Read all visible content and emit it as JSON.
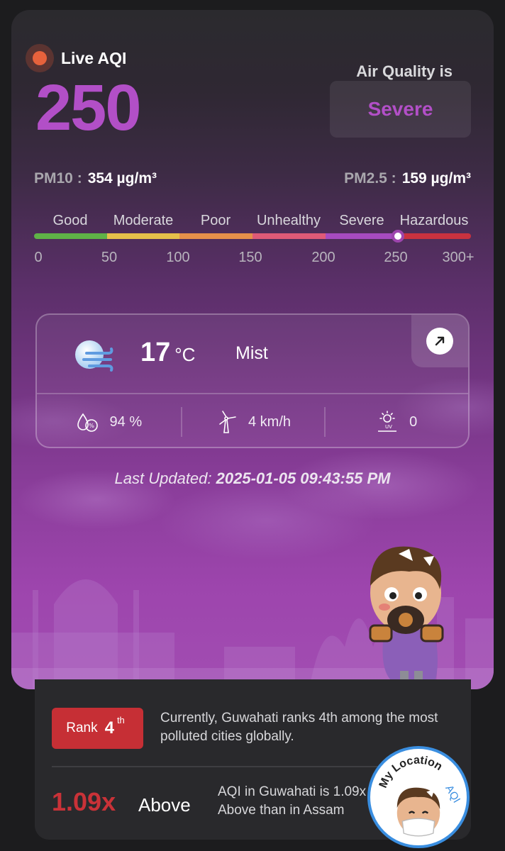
{
  "header": {
    "live_label": "Live AQI",
    "aqi_value": "250",
    "air_quality_label": "Air Quality is",
    "status": "Severe"
  },
  "pollutants": {
    "pm10_label": "PM10 :",
    "pm10_value": "354 µg/m³",
    "pm25_label": "PM2.5 :",
    "pm25_value": "159 µg/m³"
  },
  "scale": {
    "categories": [
      "Good",
      "Moderate",
      "Poor",
      "Unhealthy",
      "Severe",
      "Hazardous"
    ],
    "ticks": [
      "0",
      "50",
      "100",
      "150",
      "200",
      "250",
      "300+"
    ],
    "colors": [
      "#5fb247",
      "#e5c04a",
      "#e6904a",
      "#df5a77",
      "#a64bc0",
      "#c9323f"
    ],
    "current_value": 250
  },
  "weather": {
    "temperature": "17",
    "unit": "°C",
    "condition": "Mist",
    "humidity": "94 %",
    "wind": "4 km/h",
    "uv": "0"
  },
  "updated": {
    "label": "Last Updated:",
    "value": "2025-01-05 09:43:55 PM"
  },
  "rank": {
    "label": "Rank",
    "number": "4",
    "suffix": "th",
    "text": "Currently, Guwahati ranks 4th among the most polluted cities globally."
  },
  "comparison": {
    "multiplier": "1.09x",
    "direction": "Above",
    "text_line1": "AQI in Guwahati is 1.09x",
    "text_line2": "Above than in Assam"
  },
  "logo": {
    "text_main": "My Location",
    "text_accent": "AQI"
  }
}
